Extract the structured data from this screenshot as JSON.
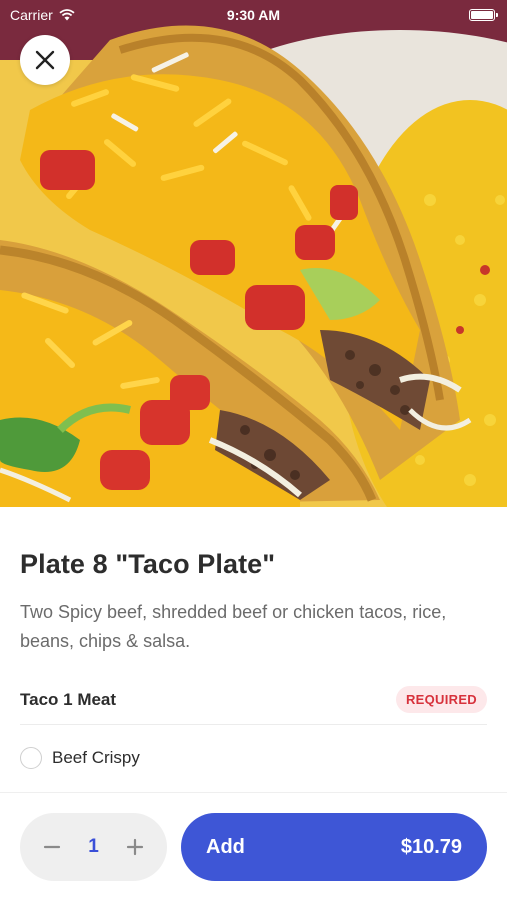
{
  "status_bar": {
    "carrier": "Carrier",
    "time": "9:30 AM",
    "text_color": "#ffffff"
  },
  "hero": {
    "icon": "close-icon"
  },
  "item": {
    "title": "Plate 8 \"Taco Plate\"",
    "description": "Two Spicy beef, shredded beef or chicken tacos, rice, beans, chips & salsa."
  },
  "section": {
    "title": "Taco 1 Meat",
    "badge": "REQUIRED",
    "badge_color": "#d7323c",
    "options": [
      {
        "label": "Beef Crispy",
        "selected": false
      }
    ]
  },
  "footer": {
    "minus_icon": "minus-icon",
    "plus_icon": "plus-icon",
    "quantity": "1",
    "add_label": "Add",
    "price": "$10.79",
    "accent": "#3e56d6"
  }
}
